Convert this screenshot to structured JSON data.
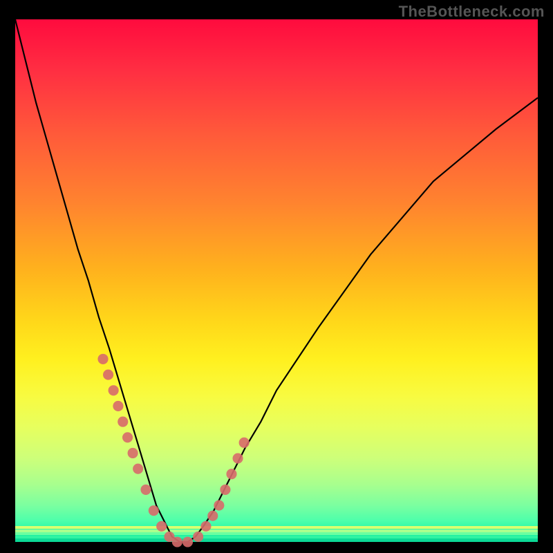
{
  "watermark": "TheBottleneck.com",
  "chart_data": {
    "type": "line",
    "title": "",
    "xlabel": "",
    "ylabel": "",
    "xlim": [
      0,
      100
    ],
    "ylim": [
      0,
      100
    ],
    "grid": false,
    "legend": false,
    "annotations": [],
    "series": [
      {
        "name": "bottleneck-curve",
        "color": "#000000",
        "x": [
          0,
          2,
          4,
          6,
          8,
          10,
          12,
          14,
          16,
          18,
          19.5,
          21,
          22.5,
          24,
          25.5,
          27,
          28.5,
          30,
          31.5,
          33,
          34.5,
          36,
          38,
          40,
          42,
          44,
          47,
          50,
          54,
          58,
          63,
          68,
          74,
          80,
          86,
          92,
          100
        ],
        "y": [
          100,
          92,
          84,
          77,
          70,
          63,
          56,
          50,
          43,
          37,
          32,
          27,
          22,
          17,
          12,
          7,
          4,
          1,
          0,
          0,
          1,
          3,
          6,
          10,
          14,
          18,
          23,
          29,
          35,
          41,
          48,
          55,
          62,
          69,
          74,
          79,
          85
        ]
      }
    ],
    "points": {
      "name": "curve-markers",
      "color": "#d76a6a",
      "radius_pct": 1.0,
      "x": [
        16.8,
        17.8,
        18.8,
        19.7,
        20.6,
        21.5,
        22.5,
        23.5,
        25.0,
        26.5,
        28.0,
        29.5,
        31.0,
        33.0,
        35.0,
        36.5,
        37.8,
        39.0,
        40.2,
        41.4,
        42.6,
        43.8
      ],
      "y": [
        35,
        32,
        29,
        26,
        23,
        20,
        17,
        14,
        10,
        6,
        3,
        1,
        0,
        0,
        1,
        3,
        5,
        7,
        10,
        13,
        16,
        19
      ]
    },
    "background": {
      "type": "vertical-gradient",
      "stops": [
        {
          "pct": 0,
          "color": "#ff0b3e"
        },
        {
          "pct": 10,
          "color": "#ff2f42"
        },
        {
          "pct": 22,
          "color": "#ff5a3a"
        },
        {
          "pct": 35,
          "color": "#ff832f"
        },
        {
          "pct": 48,
          "color": "#ffb21d"
        },
        {
          "pct": 58,
          "color": "#ffd81a"
        },
        {
          "pct": 65,
          "color": "#fff01f"
        },
        {
          "pct": 72,
          "color": "#f8fb40"
        },
        {
          "pct": 78,
          "color": "#e7ff5e"
        },
        {
          "pct": 84,
          "color": "#cdff7a"
        },
        {
          "pct": 89,
          "color": "#a8ff8e"
        },
        {
          "pct": 93,
          "color": "#7bffa0"
        },
        {
          "pct": 96,
          "color": "#4cffab"
        },
        {
          "pct": 98,
          "color": "#22f6a6"
        },
        {
          "pct": 100,
          "color": "#0de39c"
        }
      ]
    },
    "bottom_stripes": [
      {
        "y_pct": 97.0,
        "height_pct": 0.5,
        "color": "#d9ff70"
      },
      {
        "y_pct": 97.6,
        "height_pct": 0.5,
        "color": "#a8ff8e"
      },
      {
        "y_pct": 98.2,
        "height_pct": 0.5,
        "color": "#6bffa0"
      },
      {
        "y_pct": 98.8,
        "height_pct": 0.6,
        "color": "#2ef3a2"
      },
      {
        "y_pct": 99.4,
        "height_pct": 0.6,
        "color": "#0cd996"
      }
    ]
  }
}
